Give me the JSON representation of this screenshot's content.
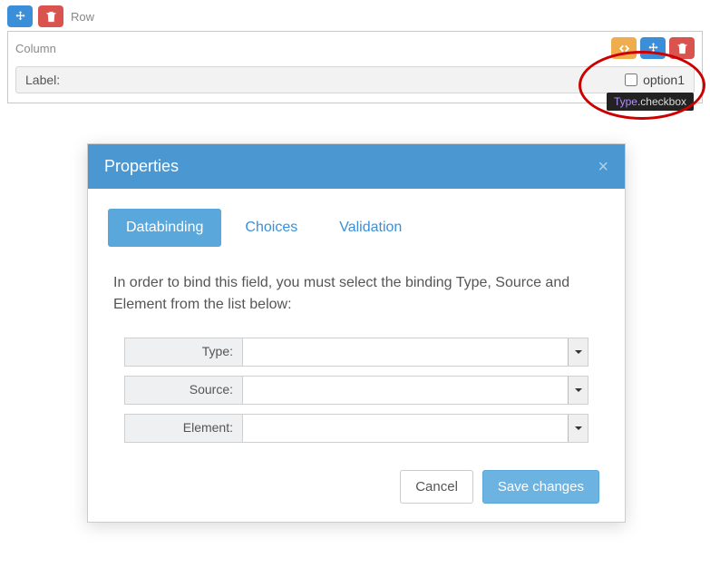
{
  "builder": {
    "row_label": "Row",
    "column_label": "Column",
    "field_label": "Label:",
    "option_label": "option1",
    "option_checked": false,
    "tooltip_type": "Type",
    "tooltip_value": "checkbox"
  },
  "modal": {
    "title": "Properties",
    "tabs": {
      "databinding": "Databinding",
      "choices": "Choices",
      "validation": "Validation"
    },
    "active_tab": "databinding",
    "instruction": "In order to bind this field, you must select the binding Type, Source and Element from the list below:",
    "fields": {
      "type_label": "Type:",
      "type_value": "",
      "source_label": "Source:",
      "source_value": "",
      "element_label": "Element:",
      "element_value": ""
    },
    "buttons": {
      "cancel": "Cancel",
      "save": "Save changes"
    }
  }
}
